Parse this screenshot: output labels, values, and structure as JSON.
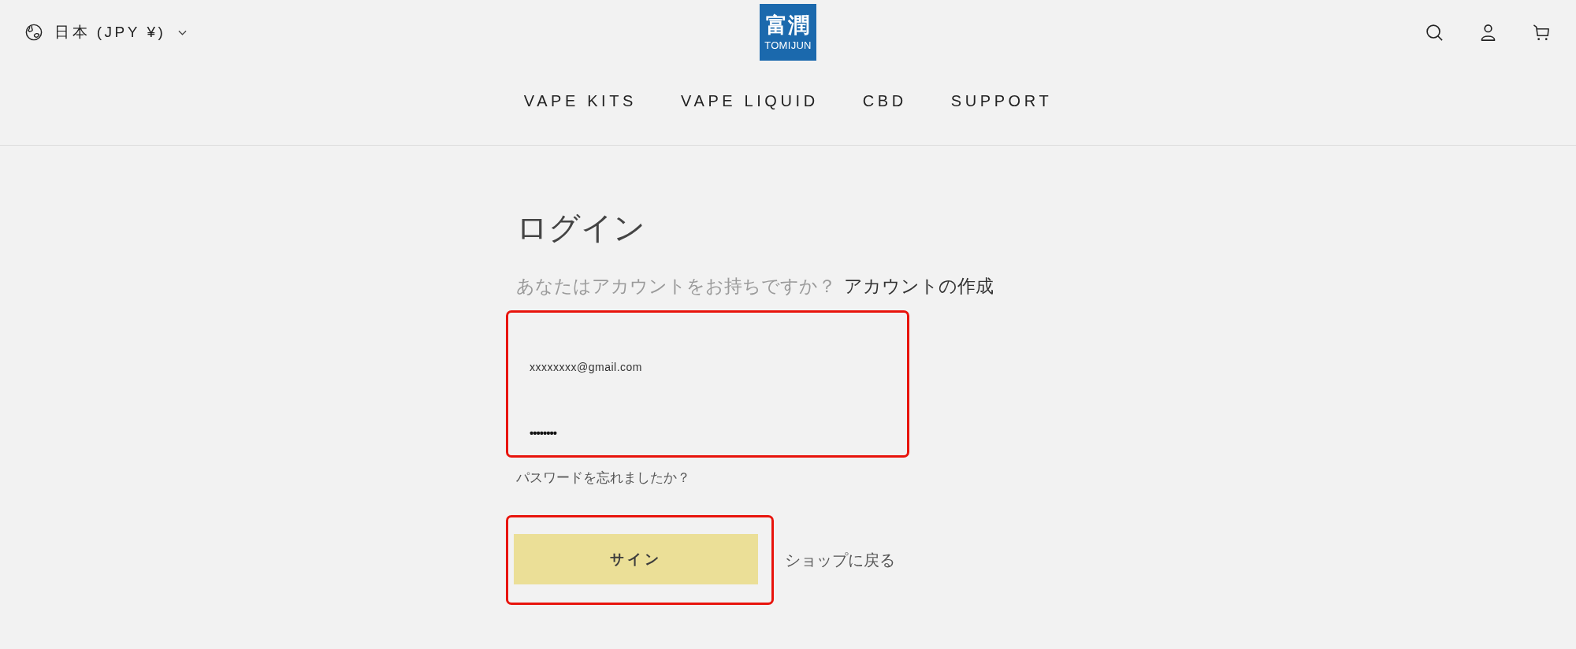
{
  "header": {
    "locale": {
      "label": "日本 (JPY ¥)"
    },
    "logo": {
      "kanji": "富潤",
      "wordmark": "TOMIJUN"
    },
    "nav": [
      {
        "label": "VAPE KITS"
      },
      {
        "label": "VAPE LIQUID"
      },
      {
        "label": "CBD"
      },
      {
        "label": "SUPPORT"
      }
    ]
  },
  "login": {
    "title": "ログイン",
    "prompt": "あなたはアカウントをお持ちですか？",
    "create_link": "アカウントの作成",
    "credentials": {
      "highlighted": true,
      "fields": [
        {
          "kind": "email",
          "value": "xxxxxxxx@gmail.com"
        },
        {
          "kind": "password",
          "value": "••••••••"
        }
      ]
    },
    "forgot_link": "パスワードを忘れましたか？",
    "submit": {
      "label": "サイン",
      "highlighted": true
    },
    "back_link": "ショップに戻る"
  }
}
